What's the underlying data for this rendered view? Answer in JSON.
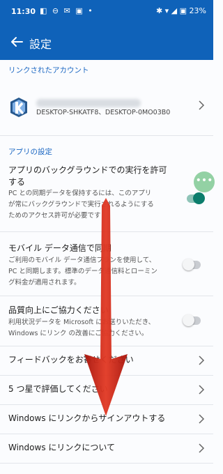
{
  "status_bar": {
    "time": "11:30",
    "left_icons": "◧ ⊖ ✉ ▣ •",
    "battery": "23%",
    "right_icons": "✱ ▾ ◢ ▣"
  },
  "app_bar": {
    "title": "設定"
  },
  "sections": {
    "linked_accounts": "リンクされたアカウント",
    "app_settings": "アプリの設定"
  },
  "account": {
    "devices": "DESKTOP-SHKATF8、DESKTOP-0MO03B0"
  },
  "settings": {
    "background": {
      "title_line1": "アプリのバックグラウンドでの実行を許可",
      "title_line2": "する",
      "desc_line1": "PC との同期データを保持するには、このアプリ",
      "desc_line2": "が常にバックグラウンドで実行されるようにする",
      "desc_line3": "ためのアクセス許可が必要です",
      "enabled": true
    },
    "mobile_data": {
      "title": "モバイル データ通信で同期",
      "desc_line1": "ご利用のモバイル データ通信プランを使用して、",
      "desc_line2": "PC と同期します。標準のデータ通信料とローミン",
      "desc_line3": "グ料金が適用されます。",
      "enabled": false
    },
    "quality": {
      "title": "品質向上にご協力ください",
      "desc_line1": "利用状況データを Microsoft にお送りいただき、",
      "desc_line2": "Windows にリンク の改善にご協力ください。",
      "enabled": false
    }
  },
  "links": {
    "feedback": "フィードバックをお寄せください",
    "rate": "5 つ星で評価してください",
    "sign_out": "Windows にリンクからサインアウトする",
    "about": "Windows にリンクについて"
  },
  "fab": {
    "label": "•••"
  },
  "colors": {
    "app_bar": "#0f62b9",
    "accent_text": "#1a66c2",
    "toggle_on": "#0c7d6c",
    "arrow": "#d32a1c"
  }
}
